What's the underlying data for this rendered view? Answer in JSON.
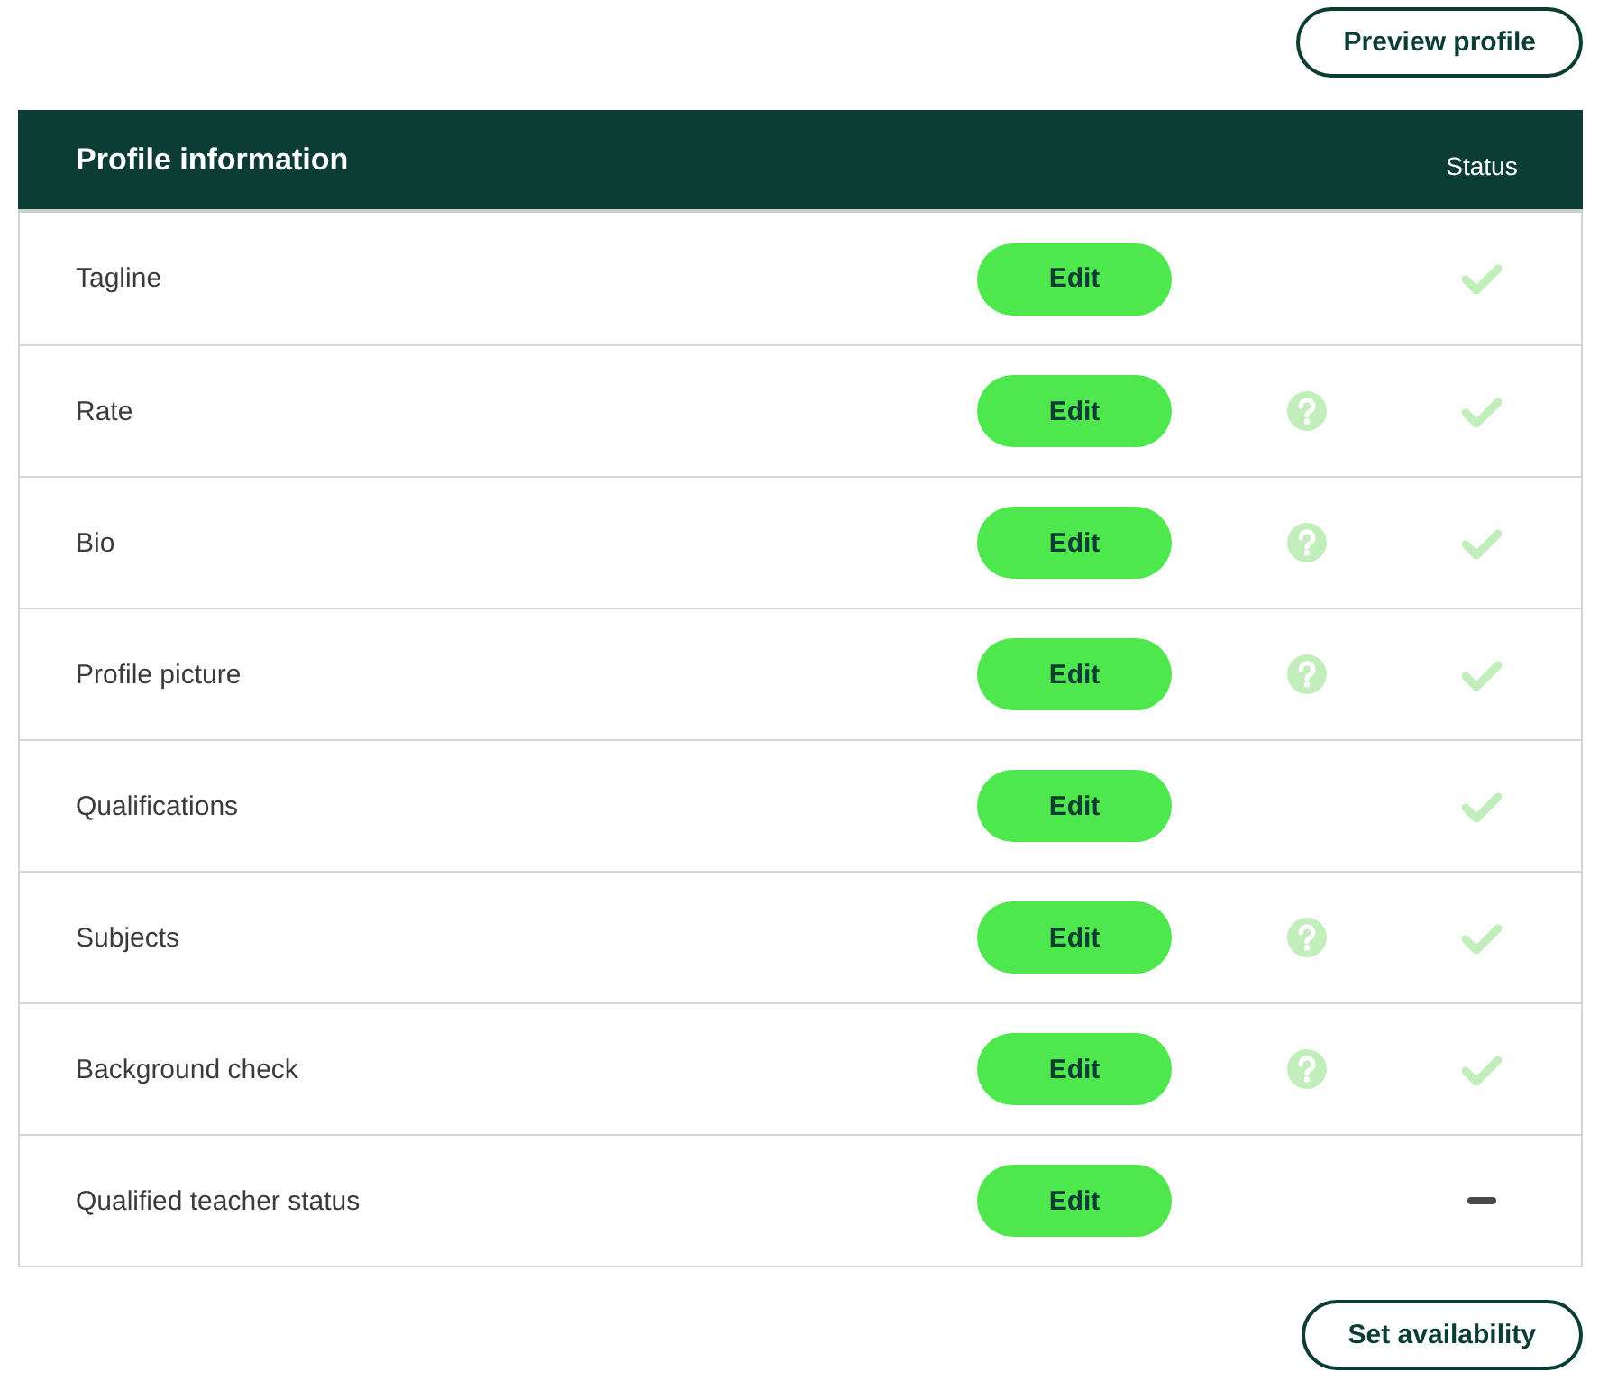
{
  "top_actions": {
    "preview_button": "Preview profile"
  },
  "table": {
    "title": "Profile information",
    "status_heading": "Status",
    "rows": [
      {
        "label": "Tagline",
        "action": "Edit",
        "help": false,
        "complete": true
      },
      {
        "label": "Rate",
        "action": "Edit",
        "help": true,
        "complete": true
      },
      {
        "label": "Bio",
        "action": "Edit",
        "help": true,
        "complete": true
      },
      {
        "label": "Profile picture",
        "action": "Edit",
        "help": true,
        "complete": true
      },
      {
        "label": "Qualifications",
        "action": "Edit",
        "help": false,
        "complete": true
      },
      {
        "label": "Subjects",
        "action": "Edit",
        "help": true,
        "complete": true
      },
      {
        "label": "Background check",
        "action": "Edit",
        "help": true,
        "complete": true
      },
      {
        "label": "Qualified teacher status",
        "action": "Edit",
        "help": false,
        "complete": false
      }
    ]
  },
  "bottom_actions": {
    "availability_button": "Set availability"
  }
}
